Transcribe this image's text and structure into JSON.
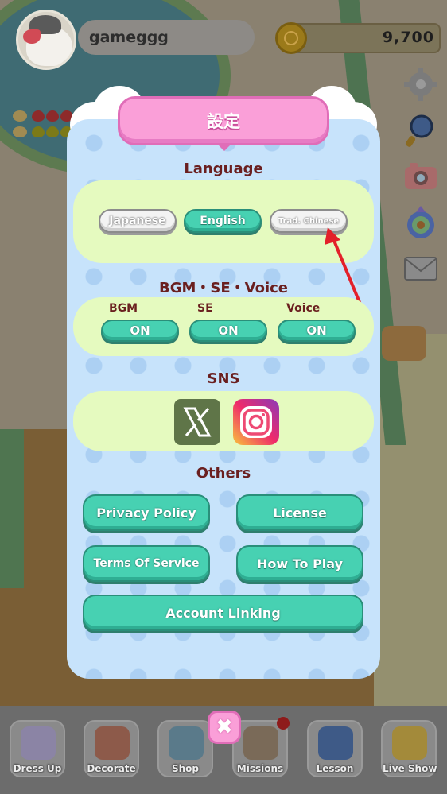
{
  "hud": {
    "username": "gameggg",
    "coins": "9,700"
  },
  "side_icons": [
    "gear-icon",
    "magnifier-icon",
    "camera-icon",
    "compass-icon",
    "mail-icon"
  ],
  "modal": {
    "title": "設定",
    "language": {
      "heading": "Language",
      "options": [
        "Japanese",
        "English",
        "Trad. Chinese"
      ],
      "selected": "English"
    },
    "audio": {
      "heading": "BGM・SE・Voice",
      "bgm_label": "BGM",
      "bgm_value": "ON",
      "se_label": "SE",
      "se_value": "ON",
      "voice_label": "Voice",
      "voice_value": "ON"
    },
    "sns": {
      "heading": "SNS",
      "icons": [
        "x-logo-icon",
        "instagram-icon"
      ]
    },
    "others": {
      "heading": "Others",
      "privacy": "Privacy Policy",
      "license": "License",
      "terms": "Terms Of Service",
      "howto": "How To Play",
      "account": "Account Linking"
    },
    "close_symbol": "✖"
  },
  "bottom_nav": {
    "items": [
      "Dress Up",
      "Decorate",
      "Shop",
      "Missions",
      "Lesson",
      "Live Show"
    ]
  },
  "colors": {
    "teal_button": "#47d1b2",
    "pink_title": "#fa9fd8",
    "panel_green": "#e5fabf",
    "modal_blue": "#c7e3fb",
    "heading_text": "#6a1f1f"
  }
}
